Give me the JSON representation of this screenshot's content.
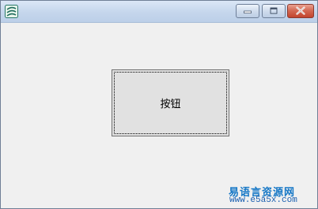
{
  "window": {
    "controls": {
      "minimize_icon": "minimize-icon",
      "maximize_icon": "maximize-icon",
      "close_icon": "close-icon"
    }
  },
  "main": {
    "button_label": "按钮"
  },
  "watermark": {
    "line1": "易语言资源网",
    "line2": "www.e5a5x.com"
  },
  "colors": {
    "close_button": "#c2442d",
    "titlebar": "#c5d6ec",
    "watermark": "#1577c6"
  }
}
